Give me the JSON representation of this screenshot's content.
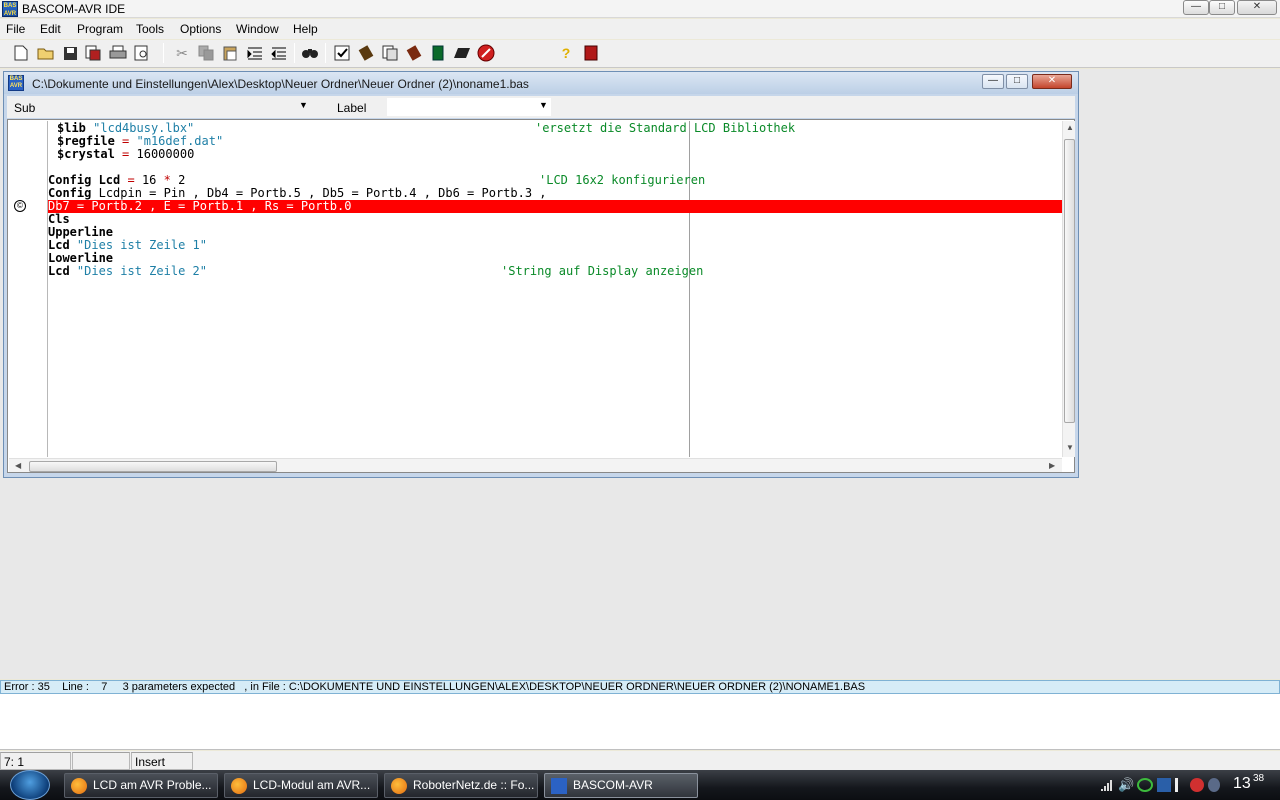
{
  "app": {
    "title": "BASCOM-AVR IDE",
    "icon_text": "BAS AVR"
  },
  "window_buttons": {
    "minimize": "—",
    "maximize": "□",
    "close": "✕"
  },
  "menu": [
    {
      "label": "File"
    },
    {
      "label": "Edit"
    },
    {
      "label": "Program"
    },
    {
      "label": "Tools"
    },
    {
      "label": "Options"
    },
    {
      "label": "Window"
    },
    {
      "label": "Help"
    }
  ],
  "toolbar": {
    "icons": [
      "new-file-icon",
      "open-folder-icon",
      "save-icon",
      "save-as-icon",
      "print-icon",
      "print-preview-icon",
      "cut-icon",
      "copy-icon",
      "paste-icon",
      "indent-icon",
      "unindent-icon",
      "find-icon",
      "syntax-check-icon",
      "compile-icon",
      "show-result-icon",
      "simulator-icon",
      "program-chip-icon",
      "terminal-icon",
      "stop-icon",
      "help-icon",
      "exit-icon"
    ]
  },
  "editor_window": {
    "path": "C:\\Dokumente und Einstellungen\\Alex\\Desktop\\Neuer Ordner\\Neuer Ordner (2)\\noname1.bas",
    "sub_label": "Sub",
    "label_label": "Label",
    "label_value": ""
  },
  "code": {
    "line1_kw": "$lib",
    "line1_str": "\"lcd4busy.lbx\"",
    "line1_cm": "'ersetzt die Standard LCD Bibliothek",
    "line2_kw": "$regfile",
    "line2_op": "=",
    "line2_str": "\"m16def.dat\"",
    "line3_kw": "$crystal",
    "line3_op": "=",
    "line3_num": "16000000",
    "line5_kw": "Config Lcd",
    "line5_op1": "=",
    "line5_num1": "16",
    "line5_op2": "*",
    "line5_num2": "2",
    "line5_cm": "'LCD 16x2 konfigurieren",
    "line6_kw": "Config",
    "line6_rest": "Lcdpin = Pin , Db4 = Portb.5 , Db5 = Portb.4 , Db6 = Portb.3 ,",
    "line7_error": "Db7 = Portb.2 , E = Portb.1 , Rs = Portb.0",
    "line8_kw": "Cls",
    "line9_kw": "Upperline",
    "line10_kw": "Lcd",
    "line10_str": "\"Dies ist Zeile 1\"",
    "line11_kw": "Lowerline",
    "line12_kw": "Lcd",
    "line12_str": "\"Dies ist Zeile 2\"",
    "line12_cm": "'String auf Display anzeigen"
  },
  "error": {
    "text": "Error : 35    Line :    7     3 parameters expected   , in File : C:\\DOKUMENTE UND EINSTELLUNGEN\\ALEX\\DESKTOP\\NEUER ORDNER\\NEUER ORDNER (2)\\NONAME1.BAS"
  },
  "status": {
    "position": "7: 1",
    "modified": "",
    "mode": "Insert"
  },
  "taskbar": {
    "tasks": [
      {
        "label": "LCD am AVR Proble..."
      },
      {
        "label": "LCD-Modul am AVR..."
      },
      {
        "label": "RoboterNetz.de :: Fo..."
      },
      {
        "label": "BASCOM-AVR"
      }
    ],
    "clock_hour": "13",
    "clock_min": "38"
  },
  "colors": {
    "error_line": "#ff0000",
    "keyword": "#000000",
    "string": "#1e7fa6",
    "comment": "#0a8a28",
    "operator": "#c00000"
  }
}
